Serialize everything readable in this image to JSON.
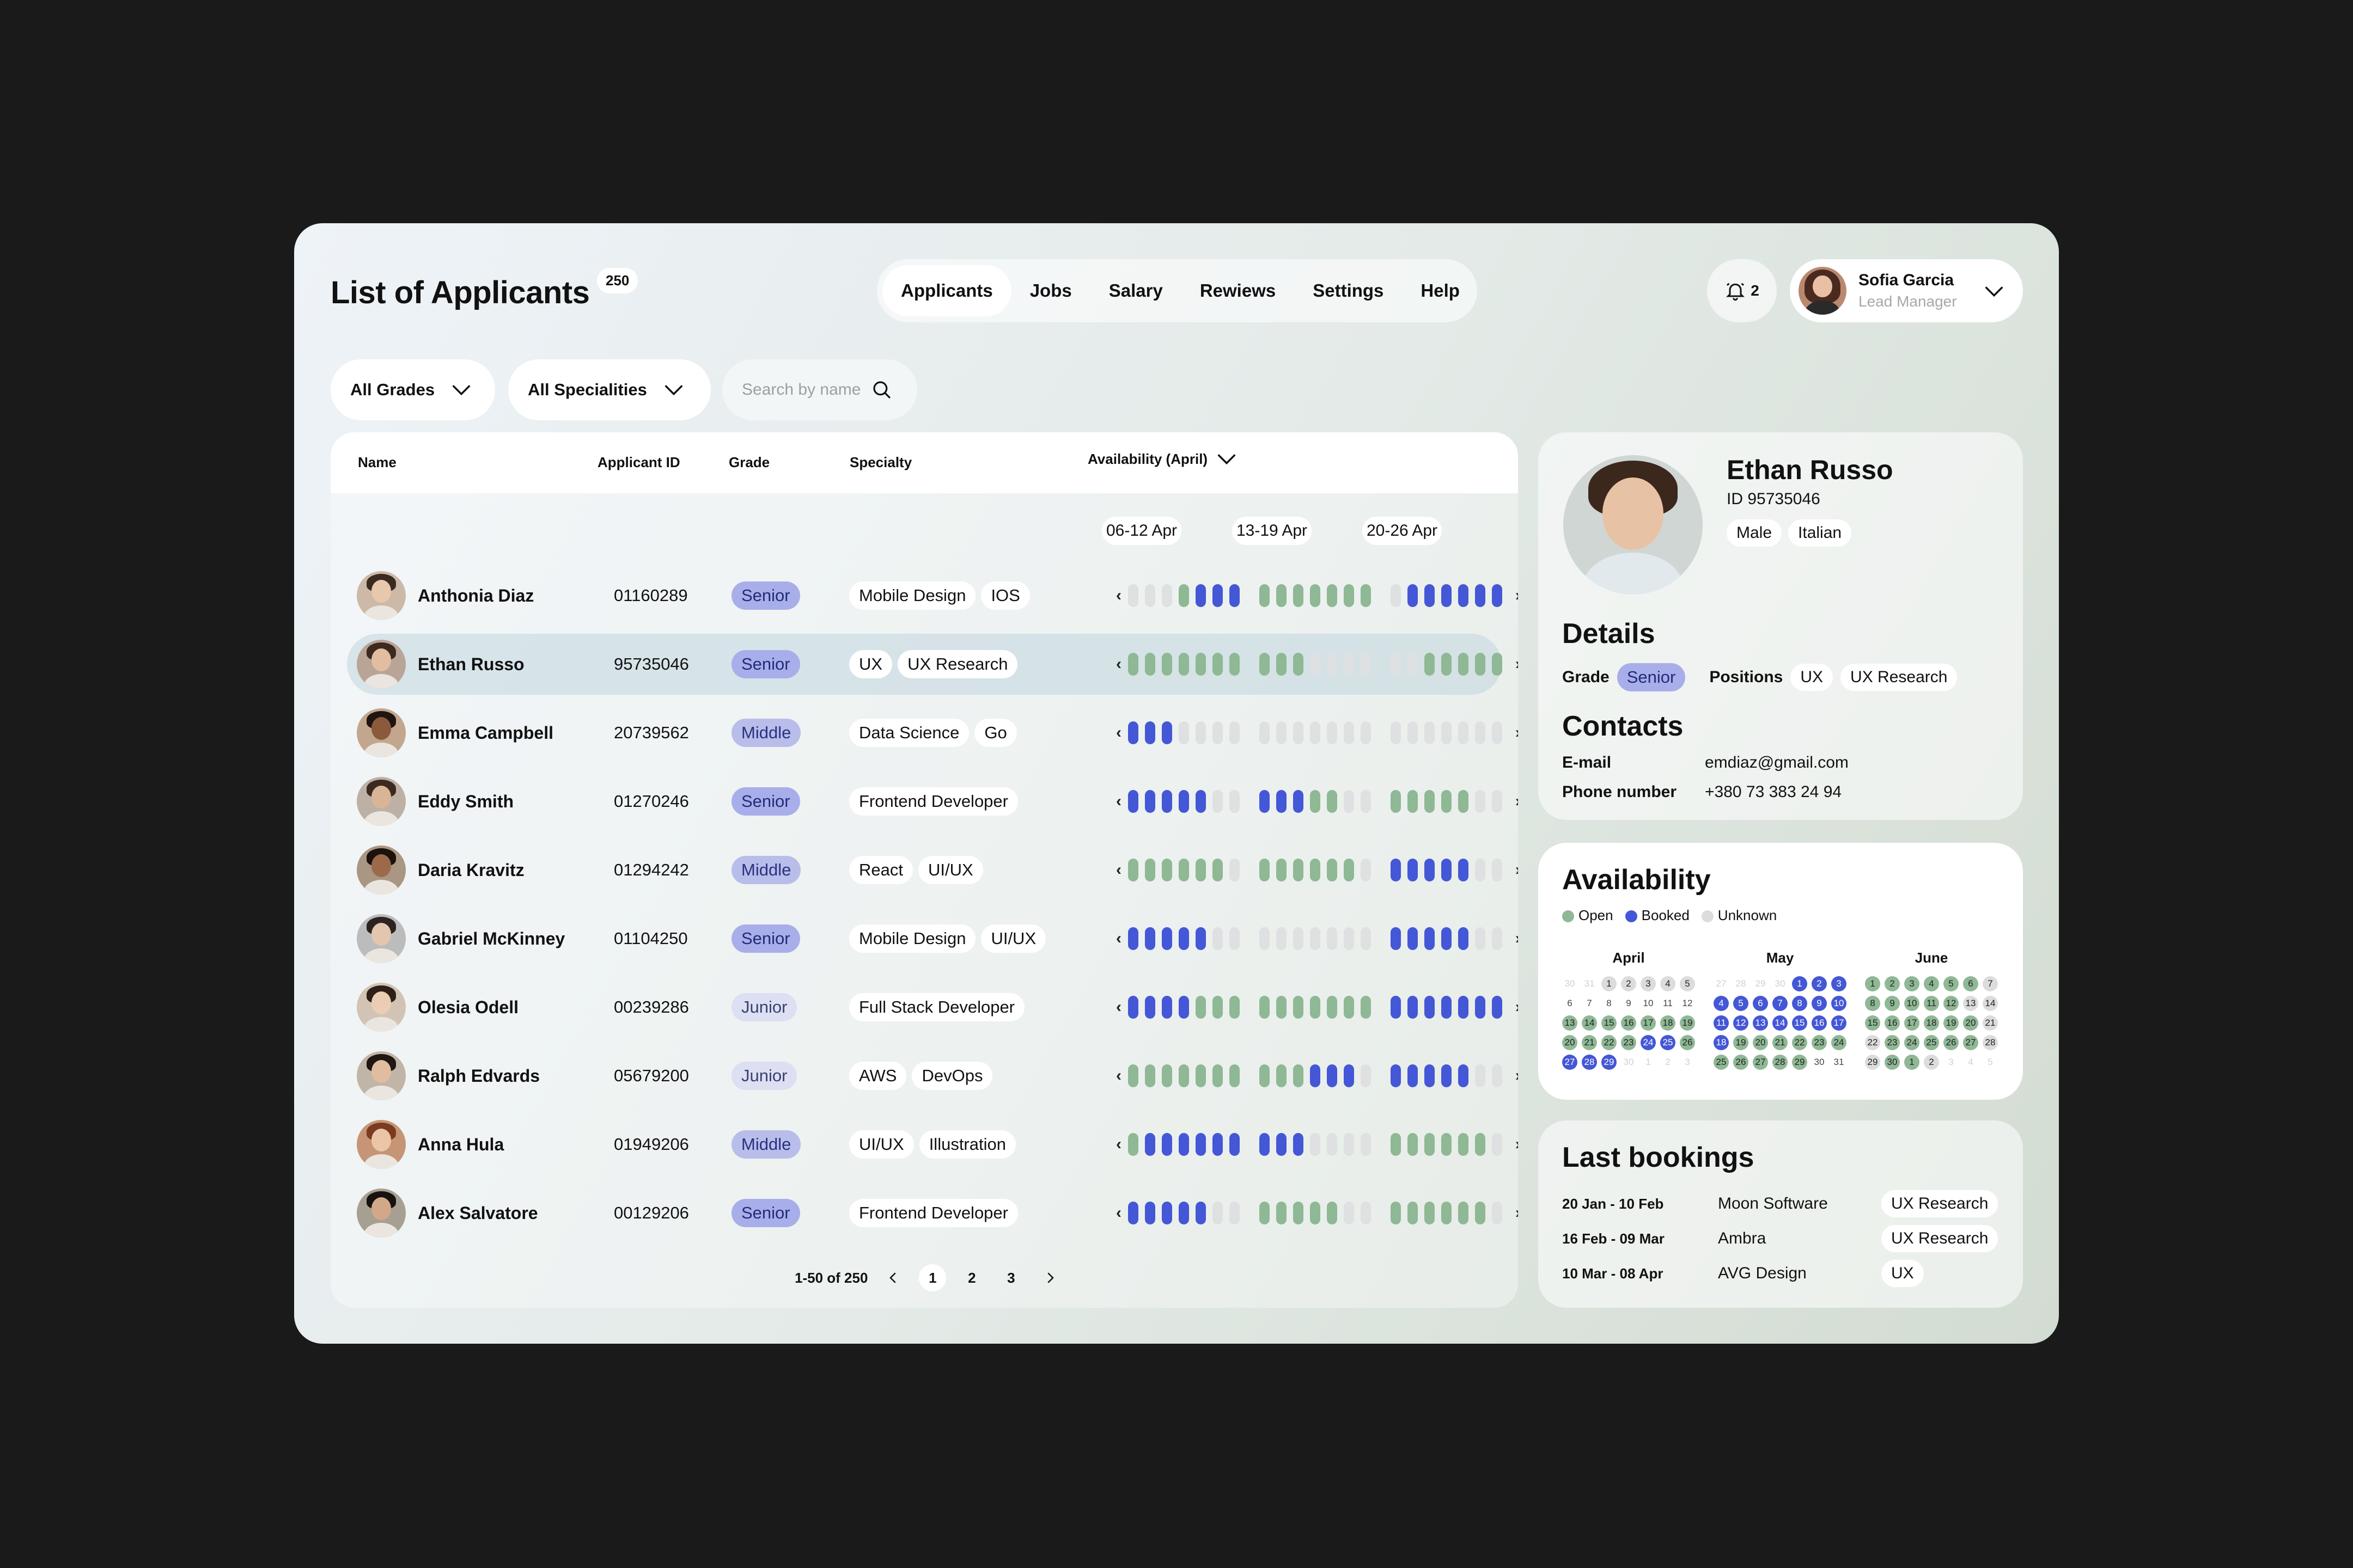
{
  "header": {
    "title": "List of Applicants",
    "count": "250",
    "nav": [
      "Applicants",
      "Jobs",
      "Salary",
      "Rewiews",
      "Settings",
      "Help"
    ],
    "active_nav": "Applicants",
    "notifications": "2",
    "user": {
      "name": "Sofia Garcia",
      "role": "Lead Manager"
    }
  },
  "filters": {
    "grades": "All Grades",
    "specialities": "All Specialities",
    "search_placeholder": "Search by name"
  },
  "table": {
    "columns": {
      "name": "Name",
      "id": "Applicant ID",
      "grade": "Grade",
      "specialty": "Specialty",
      "availability": "Availability (April)"
    },
    "weeks": [
      "06-12 Apr",
      "13-19 Apr",
      "20-26 Apr"
    ],
    "rows": [
      {
        "name": "Anthonia Diaz",
        "id": "01160289",
        "grade": "Senior",
        "specs": [
          "Mobile Design",
          "IOS"
        ],
        "avail": [
          "uuuobbbb",
          "ooooooo",
          "ubbbbbbb"
        ]
      },
      {
        "name": "Ethan Russo",
        "id": "95735046",
        "grade": "Senior",
        "specs": [
          "UX",
          "UX Research"
        ],
        "avail": [
          "ooooooo",
          "ooouuuu",
          "uuooooo"
        ]
      },
      {
        "name": "Emma Campbell",
        "id": "20739562",
        "grade": "Middle",
        "specs": [
          "Data Science",
          "Go"
        ],
        "avail": [
          "bbbuuuu",
          "uuuuuuu",
          "uuuuuuu"
        ]
      },
      {
        "name": "Eddy Smith",
        "id": "01270246",
        "grade": "Senior",
        "specs": [
          "Frontend Developer"
        ],
        "avail": [
          "bbbbbuu",
          "bbboouu",
          "ooooouu"
        ]
      },
      {
        "name": "Daria Kravitz",
        "id": "01294242",
        "grade": "Middle",
        "specs": [
          "React",
          "UI/UX"
        ],
        "avail": [
          "oooooou",
          "oooooou",
          "bbbbbuu"
        ]
      },
      {
        "name": "Gabriel McKinney",
        "id": "01104250",
        "grade": "Senior",
        "specs": [
          "Mobile Design",
          "UI/UX"
        ],
        "avail": [
          "bbbbbuu",
          "uuuuuuu",
          "bbbbbuu"
        ]
      },
      {
        "name": "Olesia Odell",
        "id": "00239286",
        "grade": "Junior",
        "specs": [
          "Full Stack Developer"
        ],
        "avail": [
          "bbbbooo",
          "ooooooo",
          "bbbbbbb"
        ]
      },
      {
        "name": "Ralph Edvards",
        "id": "05679200",
        "grade": "Junior",
        "specs": [
          "AWS",
          "DevOps"
        ],
        "avail": [
          "ooooooo",
          "ooobbbu",
          "bbbbbuu"
        ]
      },
      {
        "name": "Anna Hula",
        "id": "01949206",
        "grade": "Middle",
        "specs": [
          "UI/UX",
          "Illustration"
        ],
        "avail": [
          "obbbbbb",
          "bbbuuuu",
          "oooooou"
        ]
      },
      {
        "name": "Alex Salvatore",
        "id": "00129206",
        "grade": "Senior",
        "specs": [
          "Frontend Developer"
        ],
        "avail": [
          "bbbbbuu",
          "ooooouu",
          "oooooou"
        ]
      }
    ],
    "pager": {
      "label": "1-50 of 250",
      "pages": [
        "1",
        "2",
        "3"
      ]
    }
  },
  "profile": {
    "name": "Ethan Russo",
    "id": "ID 95735046",
    "tags": [
      "Male",
      "Italian"
    ],
    "details_title": "Details",
    "grade_label": "Grade",
    "grade": "Senior",
    "positions_label": "Positions",
    "positions": [
      "UX",
      "UX Research"
    ],
    "contacts_title": "Contacts",
    "email_label": "E-mail",
    "email": "emdiaz@gmail.com",
    "phone_label": "Phone number",
    "phone": "+380 73 383 24 94"
  },
  "availability": {
    "title": "Availability",
    "legend": [
      "Open",
      "Booked",
      "Unknown"
    ],
    "colors": {
      "open": "#8fb895",
      "booked": "#4457d6",
      "unknown": "#dfe0e1"
    },
    "months": [
      {
        "name": "April",
        "days": [
          "30",
          "31",
          "1",
          "2",
          "3",
          "4",
          "5",
          "6",
          "7",
          "8",
          "9",
          "10",
          "11",
          "12",
          "13",
          "14",
          "15",
          "16",
          "17",
          "18",
          "19",
          "20",
          "21",
          "22",
          "23",
          "24",
          "25",
          "26",
          "27",
          "28",
          "29",
          "30",
          "1",
          "2",
          "3"
        ],
        "states": "ffuuuuunnnnnnnooooooooooobbobbbffff"
      },
      {
        "name": "May",
        "days": [
          "27",
          "28",
          "29",
          "30",
          "1",
          "2",
          "3",
          "4",
          "5",
          "6",
          "7",
          "8",
          "9",
          "10",
          "11",
          "12",
          "13",
          "14",
          "15",
          "16",
          "17",
          "18",
          "19",
          "20",
          "21",
          "22",
          "23",
          "24",
          "25",
          "26",
          "27",
          "28",
          "29",
          "30",
          "31"
        ],
        "states": "ffffbbbbbbbbbbbbbbbbbbooooooooooonnnn"
      },
      {
        "name": "June",
        "days": [
          "1",
          "2",
          "3",
          "4",
          "5",
          "6",
          "7",
          "8",
          "9",
          "10",
          "11",
          "12",
          "13",
          "14",
          "15",
          "16",
          "17",
          "18",
          "19",
          "20",
          "21",
          "22",
          "23",
          "24",
          "25",
          "26",
          "27",
          "28",
          "29",
          "30",
          "1",
          "2",
          "3",
          "4",
          "5"
        ],
        "states": "oooooouooooouuoooooouuooooouuooufffff"
      }
    ]
  },
  "bookings": {
    "title": "Last bookings",
    "rows": [
      {
        "dates": "20 Jan - 10 Feb",
        "company": "Moon Software",
        "role": "UX Research"
      },
      {
        "dates": "16 Feb - 09 Mar",
        "company": "Ambra",
        "role": "UX Research"
      },
      {
        "dates": "10 Mar - 08 Apr",
        "company": "AVG Design",
        "role": "UX"
      }
    ]
  }
}
